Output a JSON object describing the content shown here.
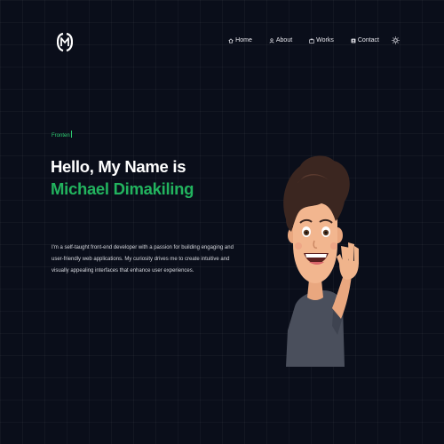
{
  "brand": {
    "logo_icon": "md-monogram-logo"
  },
  "nav": {
    "items": [
      {
        "label": "Home",
        "icon": "home-icon"
      },
      {
        "label": "About",
        "icon": "user-icon"
      },
      {
        "label": "Works",
        "icon": "briefcase-icon"
      },
      {
        "label": "Contact",
        "icon": "contact-card-icon"
      }
    ],
    "theme_toggle_icon": "sun-icon"
  },
  "hero": {
    "typing_text": "Fronten",
    "greeting": "Hello, My Name is",
    "name": "Michael Dimakiling",
    "bio": "I'm a self-taught front-end developer with a passion for building engaging and user-friendly web applications. My curiosity drives me to create intuitive and visually appealing interfaces that enhance user experiences."
  },
  "colors": {
    "background": "#0a0e1a",
    "accent": "#22b35e",
    "text": "#ffffff"
  }
}
